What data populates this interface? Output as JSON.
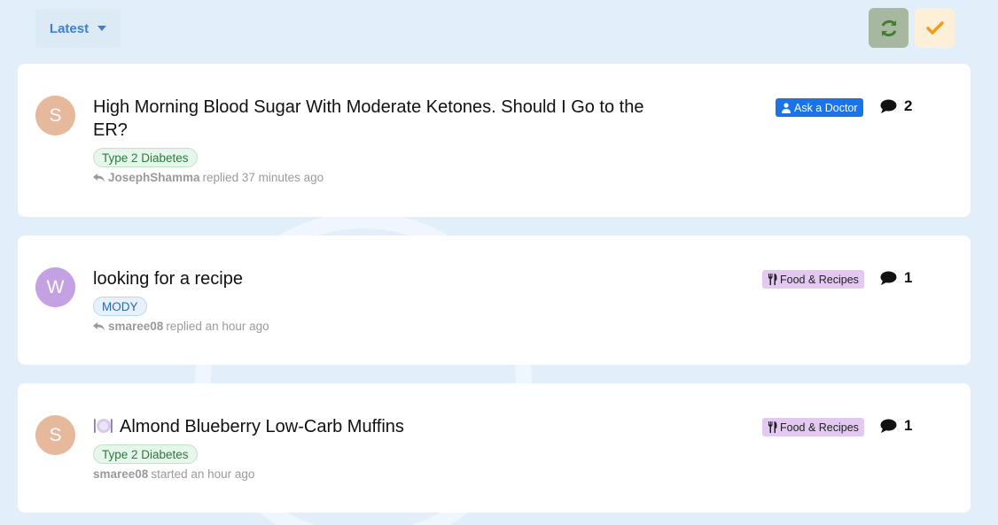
{
  "toolbar": {
    "sort_label": "Latest"
  },
  "topics": [
    {
      "avatar_letter": "S",
      "avatar_color": "#e6b89c",
      "title": "High Morning Blood Sugar With Moderate Ketones. Should I Go to the ER?",
      "tag": "Type 2 Diabetes",
      "last_user": "JosephShamma",
      "action": "replied 37 minutes ago",
      "category": "Ask a Doctor",
      "replies": "2"
    },
    {
      "avatar_letter": "W",
      "avatar_color": "#c3a1e3",
      "title": "looking for a recipe",
      "tag": "MODY",
      "last_user": "smaree08",
      "action": "replied an hour ago",
      "category": "Food & Recipes",
      "replies": "1"
    },
    {
      "avatar_letter": "S",
      "avatar_color": "#e6b89c",
      "title": "Almond Blueberry Low-Carb Muffins",
      "tag": "Type 2 Diabetes",
      "last_user": "smaree08",
      "action": "started an hour ago",
      "category": "Food & Recipes",
      "replies": "1"
    }
  ],
  "colors": {
    "page_bg": "#e3eefb",
    "doctor_badge": "#1a73e8",
    "food_badge": "#e3c8ef"
  }
}
